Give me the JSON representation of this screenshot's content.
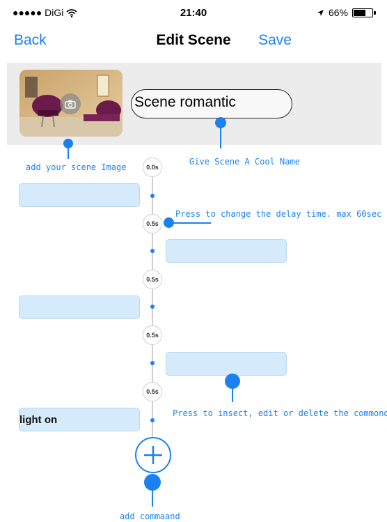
{
  "status_bar": {
    "carrier": "●●●●● DiGi",
    "time": "21:40",
    "battery": "66%",
    "battery_level": 0.66
  },
  "nav": {
    "back_label": "Back",
    "title": "Edit Scene",
    "save_label": "Save"
  },
  "scene": {
    "name": "Scene romantic"
  },
  "timeline": {
    "delays": [
      "0.0s",
      "0.5s",
      "0.5s",
      "0.5s",
      "0.5s"
    ],
    "commands": [
      "",
      "",
      "",
      "",
      "light on"
    ]
  },
  "annotations": {
    "image": "add your scene Image",
    "name": "Give Scene A Cool Name",
    "delay": "Press to change the delay time. max 60sec",
    "command": "Press to insect, edit or delete the commond",
    "add": "add commaand"
  },
  "colors": {
    "accent": "#1a82f0",
    "command_fill": "#d5ebfb",
    "header_bg": "#ececec"
  }
}
